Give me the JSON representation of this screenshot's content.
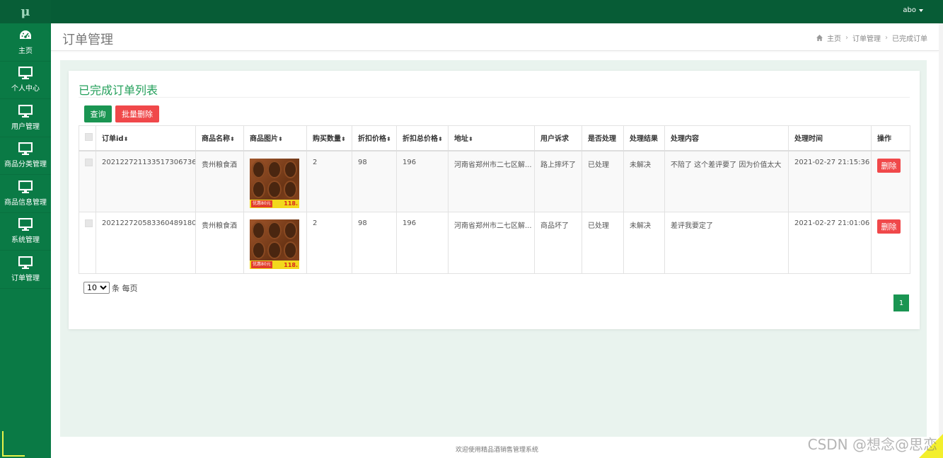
{
  "app": {
    "logo": "μ"
  },
  "topbar": {
    "user": "abo"
  },
  "sidebar": {
    "items": [
      {
        "label": "主页",
        "icon": "dashboard-icon"
      },
      {
        "label": "个人中心",
        "icon": "monitor-icon"
      },
      {
        "label": "用户管理",
        "icon": "monitor-icon"
      },
      {
        "label": "商品分类管理",
        "icon": "monitor-icon"
      },
      {
        "label": "商品信息管理",
        "icon": "monitor-icon"
      },
      {
        "label": "系统管理",
        "icon": "monitor-icon"
      },
      {
        "label": "订单管理",
        "icon": "monitor-icon"
      }
    ]
  },
  "header": {
    "title": "订单管理",
    "breadcrumb": [
      "主页",
      "订单管理",
      "已完成订单"
    ]
  },
  "panel": {
    "title": "已完成订单列表",
    "query_label": "查询",
    "batch_delete_label": "批量删除"
  },
  "table": {
    "columns": [
      "订单id",
      "商品名称",
      "商品图片",
      "购买数量",
      "折扣价格",
      "折扣总价格",
      "地址",
      "用户诉求",
      "是否处理",
      "处理结果",
      "处理内容",
      "处理时间",
      "操作"
    ],
    "sortable_marker": "⬍",
    "rows": [
      {
        "order_id": "20212272113351730673​6",
        "product_name": "贵州粮食酒",
        "image_badge_left": "优惠80元",
        "image_badge_right": "118.",
        "quantity": "2",
        "discount_price": "98",
        "discount_total": "196",
        "address": "河南省郑州市二七区解...",
        "user_request": "路上摔坏了",
        "processed": "已处理",
        "result": "未解决",
        "content": "不陪了 这个差评要了 因为价值太大",
        "time": "2021-02-27 21:15:36",
        "action": "删除"
      },
      {
        "order_id": "202122720583360489180",
        "product_name": "贵州粮食酒",
        "image_badge_left": "优惠80元",
        "image_badge_right": "118.",
        "quantity": "2",
        "discount_price": "98",
        "discount_total": "196",
        "address": "河南省郑州市二七区解...",
        "user_request": "商品坏了",
        "processed": "已处理",
        "result": "未解决",
        "content": "差评我要定了",
        "time": "2021-02-27 21:01:06",
        "action": "删除"
      }
    ]
  },
  "pagination": {
    "page_size": "10",
    "page_size_suffix": "条 每页",
    "current_page": "1"
  },
  "footer": {
    "text": "欢迎使用精品酒销售管理系统"
  },
  "watermark": "CSDN @想念@思恋",
  "colors": {
    "sidebar": "#0a7a45",
    "topbar": "#075c36",
    "accent": "#1a9552",
    "danger": "#f0484a",
    "title": "#24a05b"
  }
}
